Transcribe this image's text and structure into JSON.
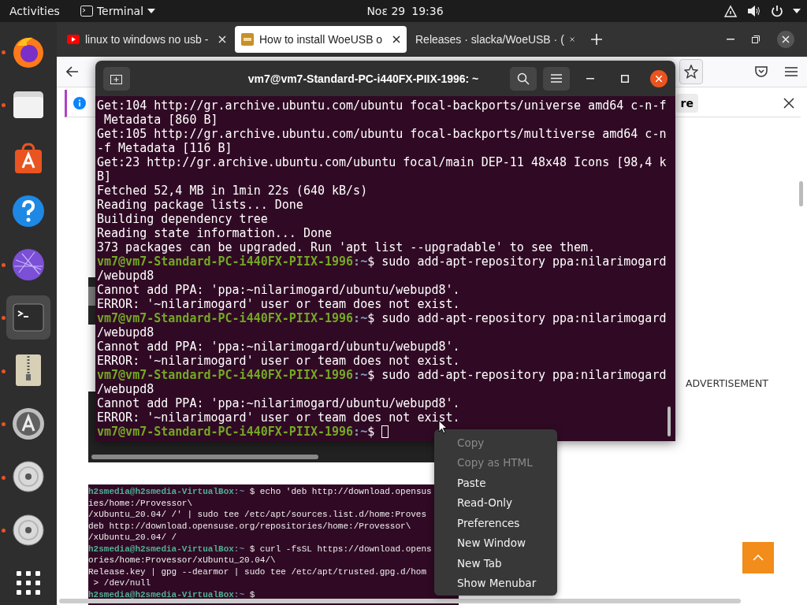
{
  "top_bar": {
    "activities": "Activities",
    "app_menu": "Terminal",
    "date": "Νοε 29",
    "time": "19:36"
  },
  "dock": [
    {
      "kind": "firefox",
      "running": true,
      "selected": false
    },
    {
      "kind": "files",
      "running": true,
      "selected": false
    },
    {
      "kind": "software",
      "running": false,
      "selected": false
    },
    {
      "kind": "help",
      "running": false,
      "selected": false
    },
    {
      "kind": "globe",
      "running": true,
      "selected": false
    },
    {
      "kind": "terminal",
      "running": true,
      "selected": true
    },
    {
      "kind": "archive",
      "running": true,
      "selected": false
    },
    {
      "kind": "updater",
      "running": true,
      "selected": false
    },
    {
      "kind": "dvd",
      "running": true,
      "selected": false
    },
    {
      "kind": "dvd",
      "running": true,
      "selected": false
    },
    {
      "kind": "apps",
      "running": false,
      "selected": false
    }
  ],
  "browser": {
    "tabs": [
      {
        "title": "linux to windows no usb -",
        "kind": "youtube",
        "selected": false
      },
      {
        "title": "How to install WoeUSB o",
        "kind": "site",
        "selected": true
      },
      {
        "title": "Releases · slacka/WoeUSB · (",
        "kind": "none",
        "selected": false
      }
    ],
    "notification": {
      "button": "re"
    },
    "page": {
      "advertisement": "ADVERTISEMENT",
      "code_lines": [
        {
          "user": "h2smedia@h2smedia-VirtualBox",
          "path": ":~",
          "command": "$ echo 'deb http://download.opensus"
        },
        {
          "text": "ies/home:/Provessor\\"
        },
        {
          "text": "/xUbuntu_20.04/ /' | sudo tee /etc/apt/sources.list.d/home:Proves"
        },
        {
          "text": "deb http://download.opensuse.org/repositories/home:/Provessor\\"
        },
        {
          "text": "/xUbuntu_20.04/ /"
        },
        {
          "user": "h2smedia@h2smedia-VirtualBox",
          "path": ":~",
          "command": "$ curl -fsSL https://download.opens"
        },
        {
          "text": "ories/home:Provessor/xUbuntu_20.04/\\"
        },
        {
          "text": "Release.key | gpg --dearmor | sudo tee /etc/apt/trusted.gpg.d/hom"
        },
        {
          "text": " > /dev/null"
        },
        {
          "user": "h2smedia@h2smedia-VirtualBox",
          "path": ":~",
          "command": "$"
        }
      ]
    }
  },
  "terminal": {
    "title": "vm7@vm7-Standard-PC-i440FX-PIIX-1996: ~",
    "lines": [
      {
        "text": "Get:104 http://gr.archive.ubuntu.com/ubuntu focal-backports/universe amd64 c-n-f"
      },
      {
        "text": " Metadata [860 B]"
      },
      {
        "text": "Get:105 http://gr.archive.ubuntu.com/ubuntu focal-backports/multiverse amd64 c-n"
      },
      {
        "text": "-f Metadata [116 B]"
      },
      {
        "text": "Get:23 http://gr.archive.ubuntu.com/ubuntu focal/main DEP-11 48x48 Icons [98,4 k"
      },
      {
        "text": "B]"
      },
      {
        "text": "Fetched 52,4 MB in 1min 22s (640 kB/s)"
      },
      {
        "text": "Reading package lists... Done"
      },
      {
        "text": "Building dependency tree"
      },
      {
        "text": "Reading state information... Done"
      },
      {
        "text": "373 packages can be upgraded. Run 'apt list --upgradable' to see them."
      },
      {
        "user": "vm7@vm7-Standard-PC-i440FX-PIIX-1996",
        "path": ":~",
        "command": "$ sudo add-apt-repository ppa:nilarimogard"
      },
      {
        "text": "/webupd8"
      },
      {
        "text": "Cannot add PPA: 'ppa:~nilarimogard/ubuntu/webupd8'."
      },
      {
        "text": "ERROR: '~nilarimogard' user or team does not exist."
      },
      {
        "user": "vm7@vm7-Standard-PC-i440FX-PIIX-1996",
        "path": ":~",
        "command": "$ sudo add-apt-repository ppa:nilarimogard"
      },
      {
        "text": "/webupd8"
      },
      {
        "text": "Cannot add PPA: 'ppa:~nilarimogard/ubuntu/webupd8'."
      },
      {
        "text": "ERROR: '~nilarimogard' user or team does not exist."
      },
      {
        "user": "vm7@vm7-Standard-PC-i440FX-PIIX-1996",
        "path": ":~",
        "command": "$ sudo add-apt-repository ppa:nilarimogard"
      },
      {
        "text": "/webupd8"
      },
      {
        "text": "Cannot add PPA: 'ppa:~nilarimogard/ubuntu/webupd8'."
      },
      {
        "text": "ERROR: '~nilarimogard' user or team does not exist."
      },
      {
        "user": "vm7@vm7-Standard-PC-i440FX-PIIX-1996",
        "path": ":~",
        "command": "$",
        "cursor": true
      }
    ]
  },
  "context_menu": [
    {
      "label": "Copy",
      "disabled": true
    },
    {
      "label": "Copy as HTML",
      "disabled": true
    },
    {
      "label": "Paste",
      "disabled": false
    },
    {
      "label": "Read-Only",
      "disabled": false
    },
    {
      "label": "Preferences",
      "disabled": false
    },
    {
      "label": "New Window",
      "disabled": false
    },
    {
      "label": "New Tab",
      "disabled": false
    },
    {
      "label": "Show Menubar",
      "disabled": false
    }
  ]
}
